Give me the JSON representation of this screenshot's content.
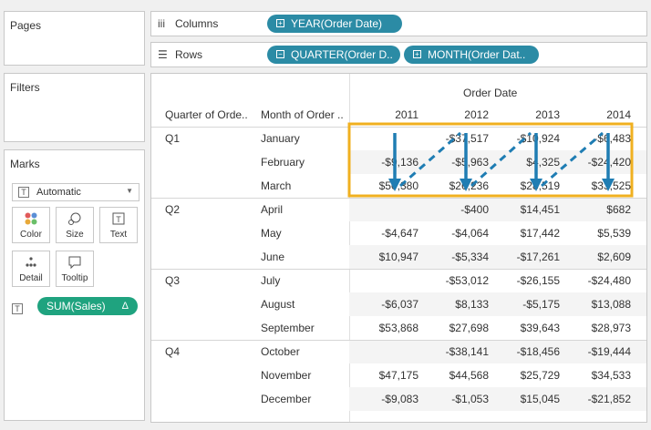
{
  "sidebar": {
    "pages_title": "Pages",
    "filters_title": "Filters",
    "marks_title": "Marks",
    "mark_type": "Automatic",
    "mark_buttons": [
      "Color",
      "Size",
      "Text",
      "Detail",
      "Tooltip"
    ],
    "sales_pill": "SUM(Sales)",
    "sales_pill_glyph": "Δ"
  },
  "columns": {
    "icon": "iii",
    "label": "Columns",
    "pills": [
      "YEAR(Order Date)"
    ]
  },
  "rows": {
    "icon": "☰",
    "label": "Rows",
    "pills": [
      "QUARTER(Order D..",
      "MONTH(Order Dat.."
    ]
  },
  "table": {
    "top_header": "Order Date",
    "col_headers": [
      "Quarter of Orde..",
      "Month of Order .."
    ],
    "years": [
      "2011",
      "2012",
      "2013",
      "2014"
    ],
    "quarters": [
      "Q1",
      "Q2",
      "Q3",
      "Q4"
    ],
    "rows": [
      {
        "month": "January",
        "values": [
          "",
          "-$37,517",
          "-$10,924",
          "-$6,483"
        ]
      },
      {
        "month": "February",
        "values": [
          "-$9,136",
          "-$5,963",
          "$4,325",
          "-$24,420"
        ]
      },
      {
        "month": "March",
        "values": [
          "$50,380",
          "$26,236",
          "$28,519",
          "$33,525"
        ]
      },
      {
        "month": "April",
        "values": [
          "",
          "-$400",
          "$14,451",
          "$682"
        ]
      },
      {
        "month": "May",
        "values": [
          "-$4,647",
          "-$4,064",
          "$17,442",
          "$5,539"
        ]
      },
      {
        "month": "June",
        "values": [
          "$10,947",
          "-$5,334",
          "-$17,261",
          "$2,609"
        ]
      },
      {
        "month": "July",
        "values": [
          "",
          "-$53,012",
          "-$26,155",
          "-$24,480"
        ]
      },
      {
        "month": "August",
        "values": [
          "-$6,037",
          "$8,133",
          "-$5,175",
          "$13,088"
        ]
      },
      {
        "month": "September",
        "values": [
          "$53,868",
          "$27,698",
          "$39,643",
          "$28,973"
        ]
      },
      {
        "month": "October",
        "values": [
          "",
          "-$38,141",
          "-$18,456",
          "-$19,444"
        ]
      },
      {
        "month": "November",
        "values": [
          "$47,175",
          "$44,568",
          "$25,729",
          "$34,533"
        ]
      },
      {
        "month": "December",
        "values": [
          "-$9,083",
          "-$1,053",
          "$15,045",
          "-$21,852"
        ]
      }
    ]
  },
  "colors": {
    "pill_blue": "#2b8ba5",
    "pill_green": "#1fa37f",
    "highlight": "#f0b020",
    "arrow": "#1f7db3"
  }
}
